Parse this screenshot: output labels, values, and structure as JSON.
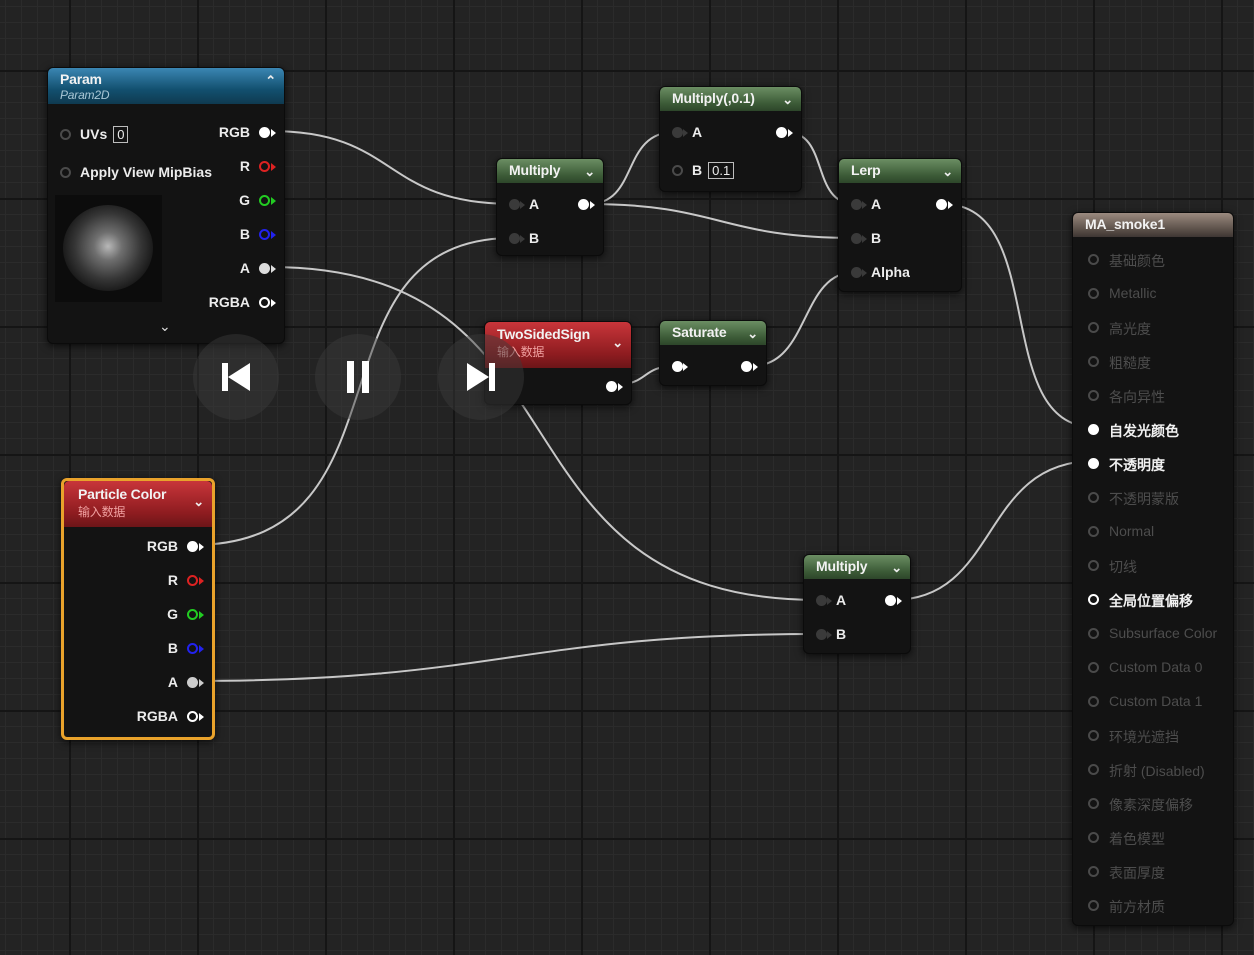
{
  "param_node": {
    "title": "Param",
    "subtitle": "Param2D",
    "uvs_label": "UVs",
    "uvs_value": "0",
    "mip_label": "Apply View MipBias",
    "outputs": [
      "RGB",
      "R",
      "G",
      "B",
      "A",
      "RGBA"
    ]
  },
  "multiply_1": {
    "title": "Multiply",
    "in_a": "A",
    "in_b": "B"
  },
  "multiply_const": {
    "title": "Multiply(,0.1)",
    "in_a": "A",
    "in_b": "B",
    "b_value": "0.1"
  },
  "lerp": {
    "title": "Lerp",
    "in_a": "A",
    "in_b": "B",
    "alpha": "Alpha"
  },
  "two_sided_sign": {
    "title": "TwoSidedSign",
    "subtitle": "输入数据"
  },
  "saturate": {
    "title": "Saturate"
  },
  "particle_color": {
    "title": "Particle Color",
    "subtitle": "输入数据",
    "outputs": [
      "RGB",
      "R",
      "G",
      "B",
      "A",
      "RGBA"
    ]
  },
  "multiply_2": {
    "title": "Multiply",
    "in_a": "A",
    "in_b": "B"
  },
  "material_output": {
    "title": "MA_smoke1",
    "inputs": [
      "基础颜色",
      "Metallic",
      "高光度",
      "粗糙度",
      "各向异性",
      "自发光颜色",
      "不透明度",
      "不透明蒙版",
      "Normal",
      "切线",
      "全局位置偏移",
      "Subsurface Color",
      "Custom Data 0",
      "Custom Data 1",
      "环境光遮挡",
      "折射 (Disabled)",
      "像素深度偏移",
      "着色模型",
      "表面厚度",
      "前方材质"
    ],
    "active": [
      "自发光颜色",
      "不透明度",
      "全局位置偏移"
    ]
  },
  "media_controls": {
    "prev_icon": "skip-back-icon",
    "pause_icon": "pause-icon",
    "next_icon": "skip-forward-icon"
  },
  "colors": {
    "wire": "#d8d8d8",
    "selected_border": "#e9a22b",
    "param_header": "#1f6890",
    "math_header": "#4a6b44",
    "input_header": "#a2252a"
  }
}
